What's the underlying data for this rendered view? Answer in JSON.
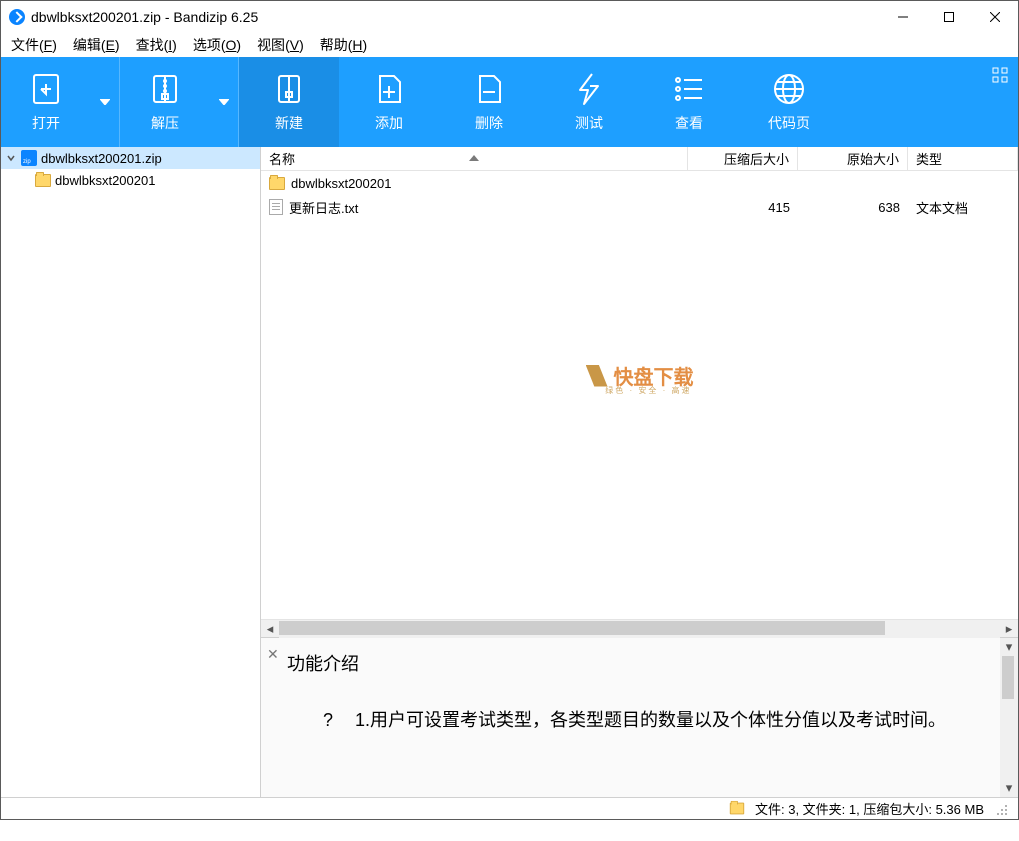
{
  "title": "dbwlbksxt200201.zip - Bandizip 6.25",
  "menus": {
    "file": {
      "label": "文件",
      "hotkey": "F"
    },
    "edit": {
      "label": "编辑",
      "hotkey": "E"
    },
    "find": {
      "label": "查找",
      "hotkey": "I"
    },
    "option": {
      "label": "选项",
      "hotkey": "O"
    },
    "view": {
      "label": "视图",
      "hotkey": "V"
    },
    "help": {
      "label": "帮助",
      "hotkey": "H"
    }
  },
  "toolbar": {
    "open": "打开",
    "extract": "解压",
    "new": "新建",
    "add": "添加",
    "delete": "删除",
    "test": "测试",
    "view": "查看",
    "codepage": "代码页"
  },
  "sidebar": {
    "root": "dbwlbksxt200201.zip",
    "child": "dbwlbksxt200201"
  },
  "columns": {
    "name": "名称",
    "compressed": "压缩后大小",
    "original": "原始大小",
    "type": "类型"
  },
  "rows": [
    {
      "icon": "folder",
      "name": "dbwlbksxt200201",
      "compressed": "",
      "original": "",
      "type": ""
    },
    {
      "icon": "txt",
      "name": "更新日志.txt",
      "compressed": "415",
      "original": "638",
      "type": "文本文档"
    }
  ],
  "watermark": {
    "brand": "快盘下载",
    "sub": "绿色 · 安全 · 高速"
  },
  "preview": {
    "title": "功能介绍",
    "qmark": "?",
    "line1": "1.用户可设置考试类型，各类型题目的数量以及个体性分值以及考试时间。"
  },
  "status": {
    "text": "文件: 3, 文件夹: 1, 压缩包大小: 5.36 MB"
  }
}
